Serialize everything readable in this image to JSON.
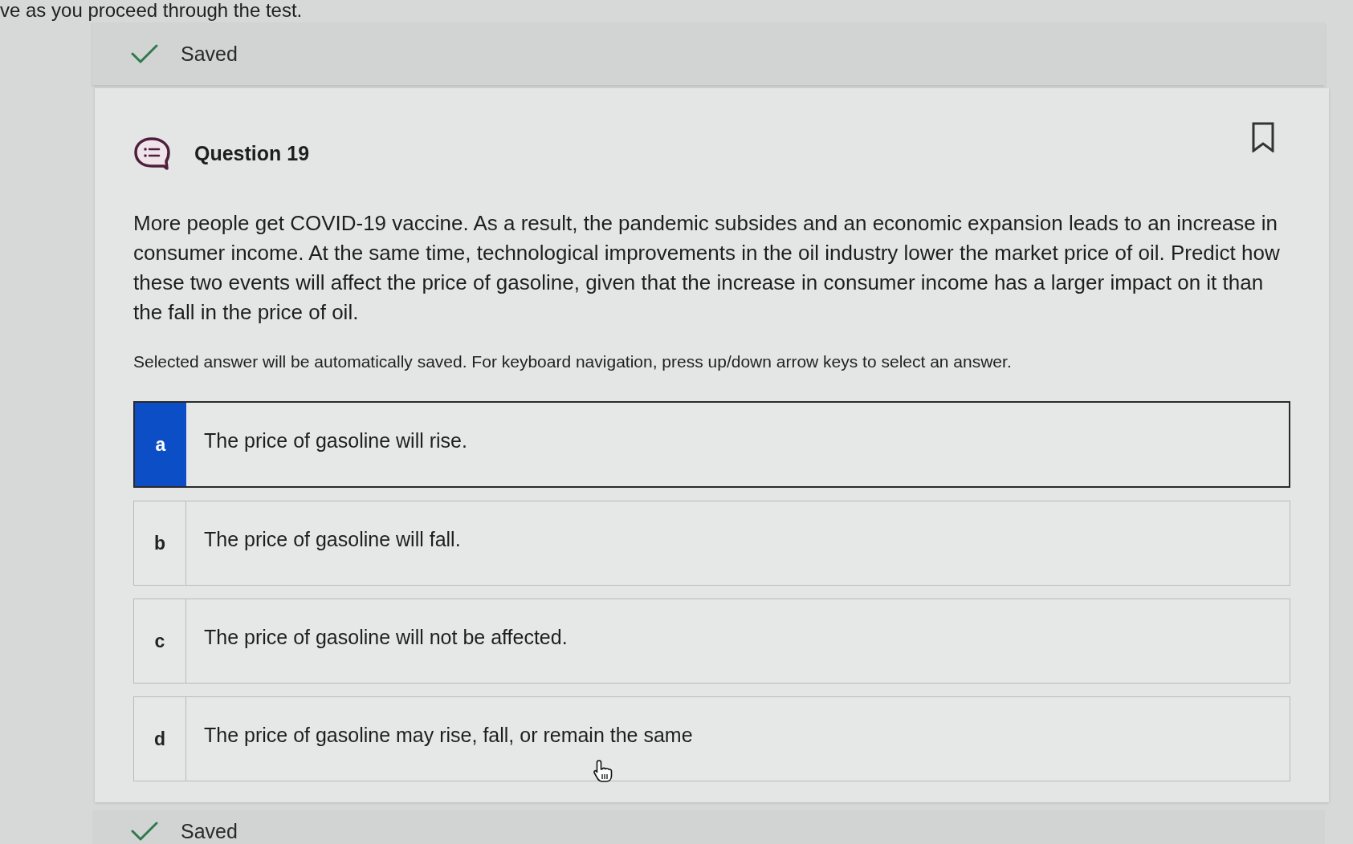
{
  "top_note": "ve as you proceed through the test.",
  "status_top": {
    "text": "Saved"
  },
  "question": {
    "title": "Question 19",
    "bookmarked": false,
    "text": "More people get COVID-19 vaccine. As a result, the pandemic subsides and an economic expansion leads to an increase in consumer income. At the same time, technological improvements in the oil industry lower the market price of oil. Predict how these two events will affect the price of gasoline, given that the increase in consumer income has a larger impact on it than the fall in the price of oil.",
    "instructions": "Selected answer will be automatically saved. For keyboard navigation, press up/down arrow keys to select an answer.",
    "options": [
      {
        "letter": "a",
        "text": "The price of gasoline will rise.",
        "selected": true
      },
      {
        "letter": "b",
        "text": "The price of gasoline will fall.",
        "selected": false
      },
      {
        "letter": "c",
        "text": "The price of gasoline will not be affected.",
        "selected": false
      },
      {
        "letter": "d",
        "text": "The price of gasoline may rise, fall, or remain the same",
        "selected": false
      }
    ]
  },
  "status_bottom": {
    "text": "Saved"
  }
}
